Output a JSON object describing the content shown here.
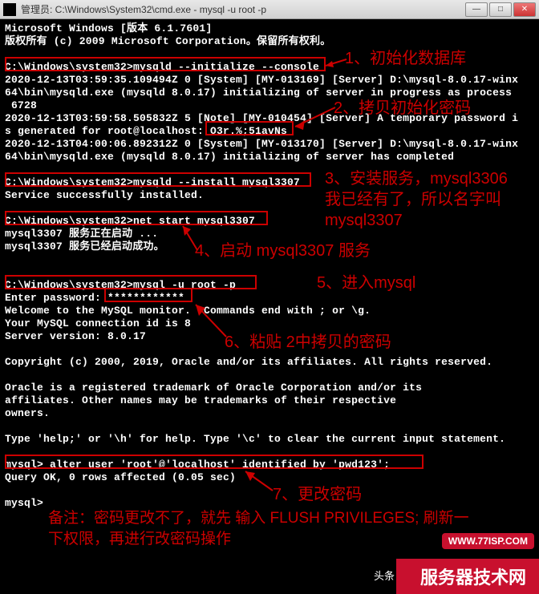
{
  "titlebar": {
    "text": "管理员: C:\\Windows\\System32\\cmd.exe - mysql  -u root -p"
  },
  "terminal": {
    "lines": [
      "Microsoft Windows [版本 6.1.7601]",
      "版权所有 (c) 2009 Microsoft Corporation。保留所有权利。",
      "",
      "C:\\Windows\\system32>mysqld --initialize --console",
      "2020-12-13T03:59:35.109494Z 0 [System] [MY-013169] [Server] D:\\mysql-8.0.17-winx",
      "64\\bin\\mysqld.exe (mysqld 8.0.17) initializing of server in progress as process",
      " 6728",
      "2020-12-13T03:59:58.505832Z 5 [Note] [MY-010454] [Server] A temporary password i",
      "s generated for root@localhost: O3r.%;51avNs",
      "2020-12-13T04:00:06.892312Z 0 [System] [MY-013170] [Server] D:\\mysql-8.0.17-winx",
      "64\\bin\\mysqld.exe (mysqld 8.0.17) initializing of server has completed",
      "",
      "C:\\Windows\\system32>mysqld --install mysql3307",
      "Service successfully installed.",
      "",
      "C:\\Windows\\system32>net start mysql3307",
      "mysql3307 服务正在启动 ...",
      "mysql3307 服务已经启动成功。",
      "",
      "",
      "C:\\Windows\\system32>mysql -u root -p",
      "Enter password: ************",
      "Welcome to the MySQL monitor.  Commands end with ; or \\g.",
      "Your MySQL connection id is 8",
      "Server version: 8.0.17",
      "",
      "Copyright (c) 2000, 2019, Oracle and/or its affiliates. All rights reserved.",
      "",
      "Oracle is a registered trademark of Oracle Corporation and/or its",
      "affiliates. Other names may be trademarks of their respective",
      "owners.",
      "",
      "Type 'help;' or '\\h' for help. Type '\\c' to clear the current input statement.",
      "",
      "mysql> alter user 'root'@'localhost' identified by 'pwd123';",
      "Query OK, 0 rows affected (0.05 sec)",
      "",
      "mysql>"
    ]
  },
  "annotations": {
    "a1": "1、初始化数据库",
    "a2": "2、拷贝初始化密码",
    "a3_line1": "3、安装服务，mysql3306",
    "a3_line2": "我已经有了，所以名字叫",
    "a3_line3": "mysql3307",
    "a4": "4、启动 mysql3307 服务",
    "a5": "5、进入mysql",
    "a6": "6、粘贴 2中拷贝的密码",
    "a7": "7、更改密码",
    "note_line1": "备注：密码更改不了，就先 输入 FLUSH PRIVILEGES; 刷新一",
    "note_line2": "下权限，再进行改密码操作"
  },
  "watermark": "WWW.77ISP.COM",
  "footer": "服务器技术网",
  "toutiao": "头条"
}
